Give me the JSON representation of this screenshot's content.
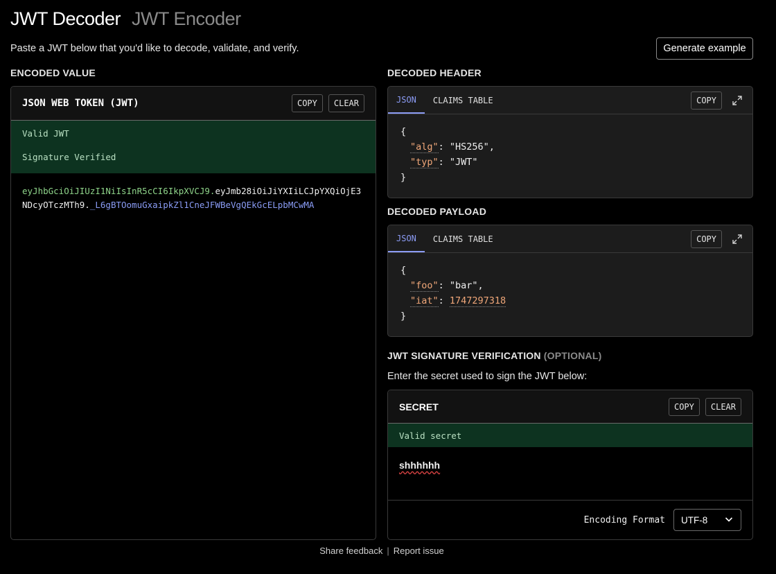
{
  "nav": {
    "decoder_tab": "JWT Decoder",
    "encoder_tab": "JWT Encoder"
  },
  "subtitle": "Paste a JWT below that you'd like to decode, validate, and verify.",
  "generate_button": "Generate example",
  "encoded": {
    "section_label": "ENCODED VALUE",
    "panel_title": "JSON WEB TOKEN (JWT)",
    "copy_label": "COPY",
    "clear_label": "CLEAR",
    "status_valid": "Valid JWT",
    "status_signature": "Signature Verified",
    "token_header": "eyJhbGciOiJIUzI1NiIsInR5cCI6IkpXVCJ9.",
    "token_payload": "eyJmb28iOiJiYXIiLCJpYXQiOjE3NDcyOTczMTh9.",
    "token_signature": "_L6gBTOomuGxaipkZl1CneJFWBeVgQEkGcELpbMCwMA"
  },
  "header_panel": {
    "section_label": "DECODED HEADER",
    "tab_json": "JSON",
    "tab_claims": "CLAIMS TABLE",
    "copy_label": "COPY",
    "open_brace": "{",
    "close_brace": "}",
    "entries": [
      {
        "key": "\"alg\"",
        "value": "\"HS256\","
      },
      {
        "key": "\"typ\"",
        "value": "\"JWT\""
      }
    ]
  },
  "payload_panel": {
    "section_label": "DECODED PAYLOAD",
    "tab_json": "JSON",
    "tab_claims": "CLAIMS TABLE",
    "copy_label": "COPY",
    "open_brace": "{",
    "close_brace": "}",
    "entries": [
      {
        "key": "\"foo\"",
        "value": "\"bar\","
      },
      {
        "key": "\"iat\"",
        "value": "1747297318"
      }
    ]
  },
  "verification": {
    "section_label": "JWT SIGNATURE VERIFICATION",
    "optional_label": "(OPTIONAL)",
    "description": "Enter the secret used to sign the JWT below:",
    "panel_title": "SECRET",
    "copy_label": "COPY",
    "clear_label": "CLEAR",
    "status": "Valid secret",
    "secret_value": "shhhhhh",
    "encoding_label": "Encoding Format",
    "encoding_value": "UTF-8"
  },
  "footer": {
    "feedback": "Share feedback",
    "separator": "|",
    "report": "Report issue"
  },
  "colors": {
    "valid_bg": "#0d3320",
    "accent": "#8c9cf5",
    "json_key": "#f0a779",
    "token_header": "#8fd48a",
    "token_signature": "#8a9cf5"
  }
}
